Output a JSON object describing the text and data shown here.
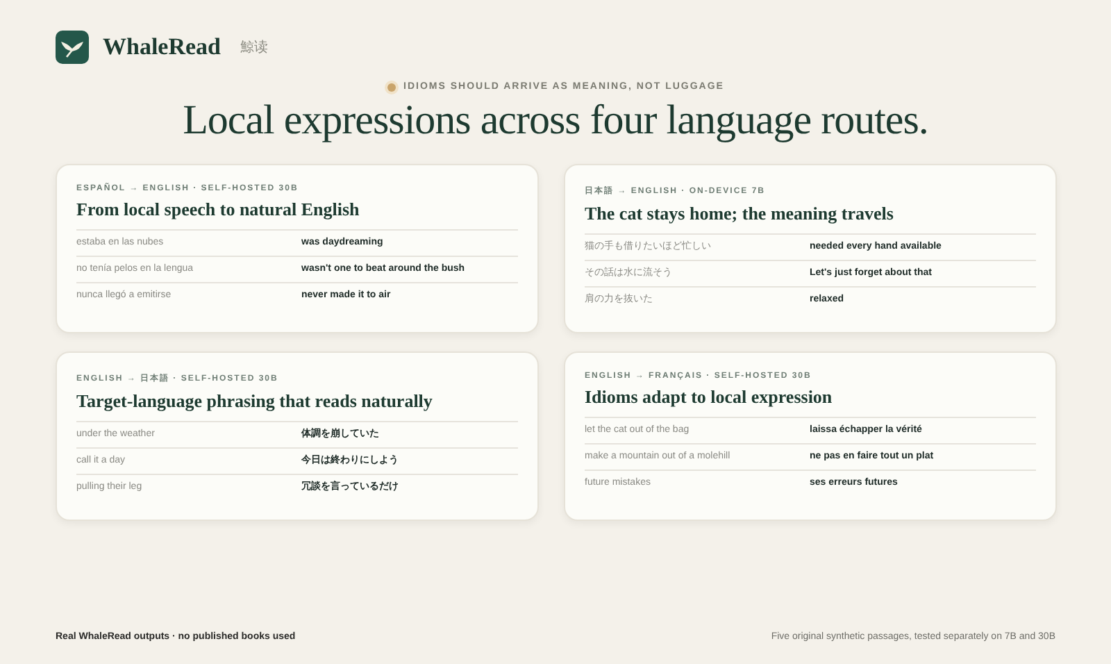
{
  "brand": {
    "name": "WhaleRead",
    "subtitle": "鯨读"
  },
  "eyebrow": "IDIOMS SHOULD ARRIVE AS MEANING, NOT LUGGAGE",
  "headline": "Local expressions across four language routes.",
  "cards": [
    {
      "route": "ESPAÑOL → ENGLISH · SELF-HOSTED 30B",
      "title": "From local speech to natural English",
      "rows": [
        {
          "source": "estaba en las nubes",
          "target": "was daydreaming"
        },
        {
          "source": "no tenía pelos en la lengua",
          "target": "wasn't one to beat around the bush"
        },
        {
          "source": "nunca llegó a emitirse",
          "target": "never made it to air"
        }
      ]
    },
    {
      "route": "日本語 → ENGLISH · ON-DEVICE 7B",
      "title": "The cat stays home; the meaning travels",
      "rows": [
        {
          "source": "猫の手も借りたいほど忙しい",
          "target": "needed every hand available"
        },
        {
          "source": "その話は水に流そう",
          "target": "Let's just forget about that"
        },
        {
          "source": "肩の力を抜いた",
          "target": "relaxed"
        }
      ]
    },
    {
      "route": "ENGLISH → 日本語 · SELF-HOSTED 30B",
      "title": "Target-language phrasing that reads naturally",
      "rows": [
        {
          "source": "under the weather",
          "target": "体調を崩していた"
        },
        {
          "source": "call it a day",
          "target": "今日は終わりにしよう"
        },
        {
          "source": "pulling their leg",
          "target": "冗談を言っているだけ"
        }
      ]
    },
    {
      "route": "ENGLISH → FRANÇAIS · SELF-HOSTED 30B",
      "title": "Idioms adapt to local expression",
      "rows": [
        {
          "source": "let the cat out of the bag",
          "target": "laissa échapper la vérité"
        },
        {
          "source": "make a mountain out of a molehill",
          "target": "ne pas en faire tout un plat"
        },
        {
          "source": "future mistakes",
          "target": "ses erreurs futures"
        }
      ]
    }
  ],
  "footer": {
    "left": "Real WhaleRead outputs · no published books used",
    "right": "Five original synthetic passages, tested separately on 7B and 30B"
  }
}
